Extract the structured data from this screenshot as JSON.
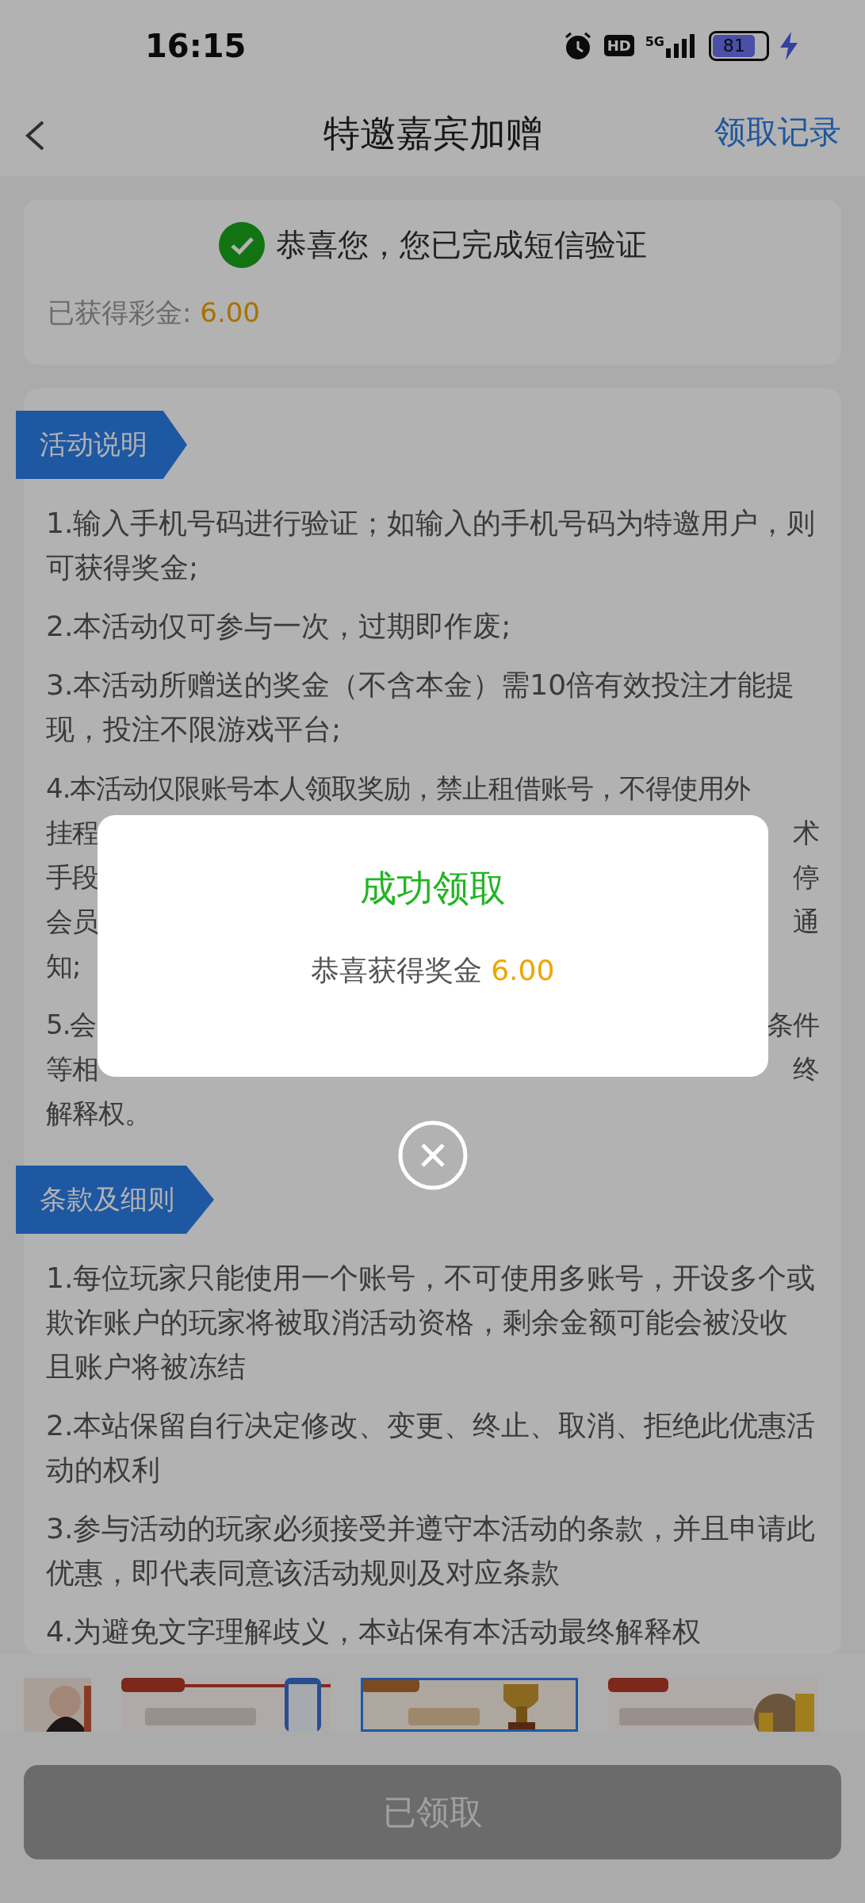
{
  "status_bar": {
    "time": "16:15",
    "hd": "HD",
    "network": "5G",
    "battery": "81"
  },
  "header": {
    "title": "特邀嘉宾加赠",
    "action": "领取记录"
  },
  "verify_card": {
    "message": "恭喜您，您已完成短信验证",
    "earned_label": "已获得彩金: ",
    "earned_amount": "6.00"
  },
  "sections": [
    {
      "tag": "活动说明",
      "items": [
        {
          "kind": "text",
          "lines": [
            "1.输入手机号码进行验证；如输入的手机号码为特邀用户，则",
            "可获得奖金;"
          ]
        },
        {
          "kind": "text",
          "lines": [
            "2.本活动仅可参与一次，过期即作废;"
          ]
        },
        {
          "kind": "text",
          "lines": [
            "3.本活动所赠送的奖金（不含本金）需10倍有效投注才能提",
            "现，投注不限游戏平台;"
          ]
        },
        {
          "kind": "covered",
          "lines": [
            {
              "left": "4.本活动仅限账号本人领取奖励，禁止租借账号，不得使用外"
            },
            {
              "left": "挂程",
              "right": "术"
            },
            {
              "left": "手段",
              "right": "停"
            },
            {
              "left": "会员",
              "right": "通"
            },
            {
              "left": "知;"
            }
          ]
        },
        {
          "kind": "covered",
          "lines": [
            {
              "left": "5.会",
              "right": "条件"
            },
            {
              "left": "等相",
              "right": "终"
            },
            {
              "left": "解释权。"
            }
          ]
        }
      ]
    },
    {
      "tag": "条款及细则",
      "items": [
        {
          "kind": "text",
          "lines": [
            "1.每位玩家只能使用一个账号，不可使用多账号，开设多个或",
            "欺诈账户的玩家将被取消活动资格，剩余金额可能会被没收",
            "且账户将被冻结"
          ]
        },
        {
          "kind": "text",
          "lines": [
            "2.本站保留自行决定修改、变更、终止、取消、拒绝此优惠活",
            "动的权利"
          ]
        },
        {
          "kind": "text",
          "lines": [
            "3.参与活动的玩家必须接受并遵守本活动的条款，并且申请此",
            "优惠，即代表同意该活动规则及对应条款"
          ]
        },
        {
          "kind": "text",
          "lines": [
            "4.为避免文字理解歧义，本站保有本活动最终解释权"
          ]
        }
      ]
    }
  ],
  "banners": [
    {
      "kind": "picture",
      "selected": false
    },
    {
      "kind": "picture",
      "selected": false
    },
    {
      "kind": "picture",
      "selected": true
    },
    {
      "kind": "picture",
      "selected": false
    }
  ],
  "claim_button": {
    "label": "已领取",
    "disabled": true
  },
  "dialog": {
    "title": "成功领取",
    "message": "恭喜获得奖金 ",
    "amount": "6.00"
  }
}
